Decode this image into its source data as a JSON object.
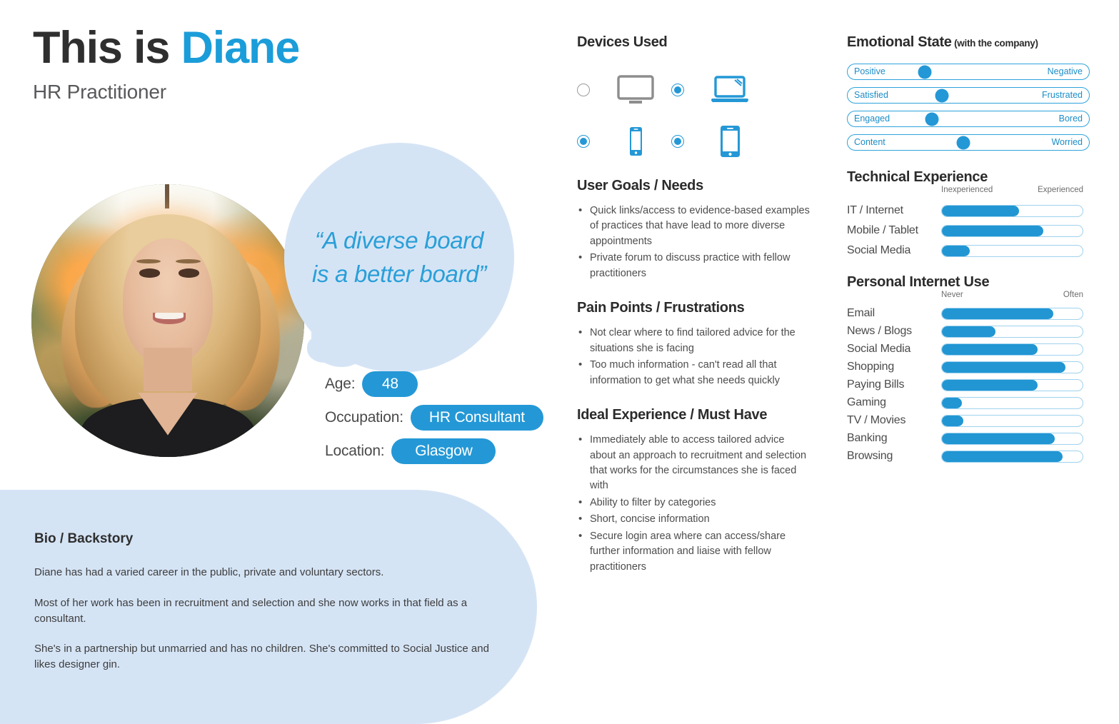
{
  "header": {
    "title_prefix": "This is ",
    "title_name": "Diane",
    "role": "HR Practitioner"
  },
  "quote": "“A diverse board is a better board”",
  "demographics": [
    {
      "label": "Age:",
      "value": "48"
    },
    {
      "label": "Occupation:",
      "value": "HR Consultant"
    },
    {
      "label": "Location:",
      "value": "Glasgow"
    }
  ],
  "bio": {
    "heading": "Bio / Backstory",
    "paragraphs": [
      "Diane has had a varied career in the public, private and voluntary sectors.",
      "Most of her work has been in recruitment and selection and she now works in that field as a consultant.",
      "She's in a partnership but unmarried and has no children. She's committed to Social Justice and likes designer gin."
    ]
  },
  "devices": {
    "heading": "Devices Used",
    "items": [
      {
        "icon": "desktop-monitor-icon",
        "label": "Desktop",
        "selected": false
      },
      {
        "icon": "laptop-icon",
        "label": "Laptop",
        "selected": true
      },
      {
        "icon": "mobile-phone-icon",
        "label": "Mobile Phone",
        "selected": true
      },
      {
        "icon": "tablet-icon",
        "label": "Tablet",
        "selected": true
      }
    ]
  },
  "user_goals": {
    "heading": "User Goals / Needs",
    "items": [
      "Quick links/access to evidence-based examples of practices that have lead to more diverse appointments",
      "Private forum to discuss practice with fellow practitioners"
    ]
  },
  "pain_points": {
    "heading": "Pain Points / Frustrations",
    "items": [
      "Not clear where to find tailored advice for the situations she is facing",
      "Too much information - can't read all that information to get what she needs quickly"
    ]
  },
  "ideal_experience": {
    "heading": "Ideal Experience / Must Have",
    "items": [
      "Immediately able to access tailored advice about an approach to recruitment and selection that works for the circumstances she is faced with",
      "Ability to filter by categories",
      "Short, concise information",
      "Secure login area where can access/share further information and liaise with fellow practitioners"
    ]
  },
  "emotional_state": {
    "heading": "Emotional State",
    "heading_sub": " (with the company)",
    "rows": [
      {
        "left": "Positive",
        "right": "Negative",
        "position": 32
      },
      {
        "left": "Satisfied",
        "right": "Frustrated",
        "position": 39
      },
      {
        "left": "Engaged",
        "right": "Bored",
        "position": 35
      },
      {
        "left": "Content",
        "right": "Worried",
        "position": 48
      }
    ]
  },
  "technical_experience": {
    "heading": "Technical Experience",
    "scale_min": "Inexperienced",
    "scale_max": "Experienced",
    "rows": [
      {
        "label": "IT / Internet",
        "value": 55
      },
      {
        "label": "Mobile / Tablet",
        "value": 72
      },
      {
        "label": "Social Media",
        "value": 20
      }
    ]
  },
  "personal_internet_use": {
    "heading": "Personal Internet Use",
    "scale_min": "Never",
    "scale_max": "Often",
    "rows": [
      {
        "label": "Email",
        "value": 79
      },
      {
        "label": "News / Blogs",
        "value": 38
      },
      {
        "label": "Social Media",
        "value": 68
      },
      {
        "label": "Shopping",
        "value": 88
      },
      {
        "label": "Paying Bills",
        "value": 68
      },
      {
        "label": "Gaming",
        "value": 14
      },
      {
        "label": "TV / Movies",
        "value": 15
      },
      {
        "label": "Banking",
        "value": 80
      },
      {
        "label": "Browsing",
        "value": 86
      }
    ]
  },
  "colors": {
    "accent_blue": "#2498d6",
    "light_blue": "#d5e4f5",
    "heading_dark": "#2b2b2b",
    "body_gray": "#4d4d4d"
  }
}
